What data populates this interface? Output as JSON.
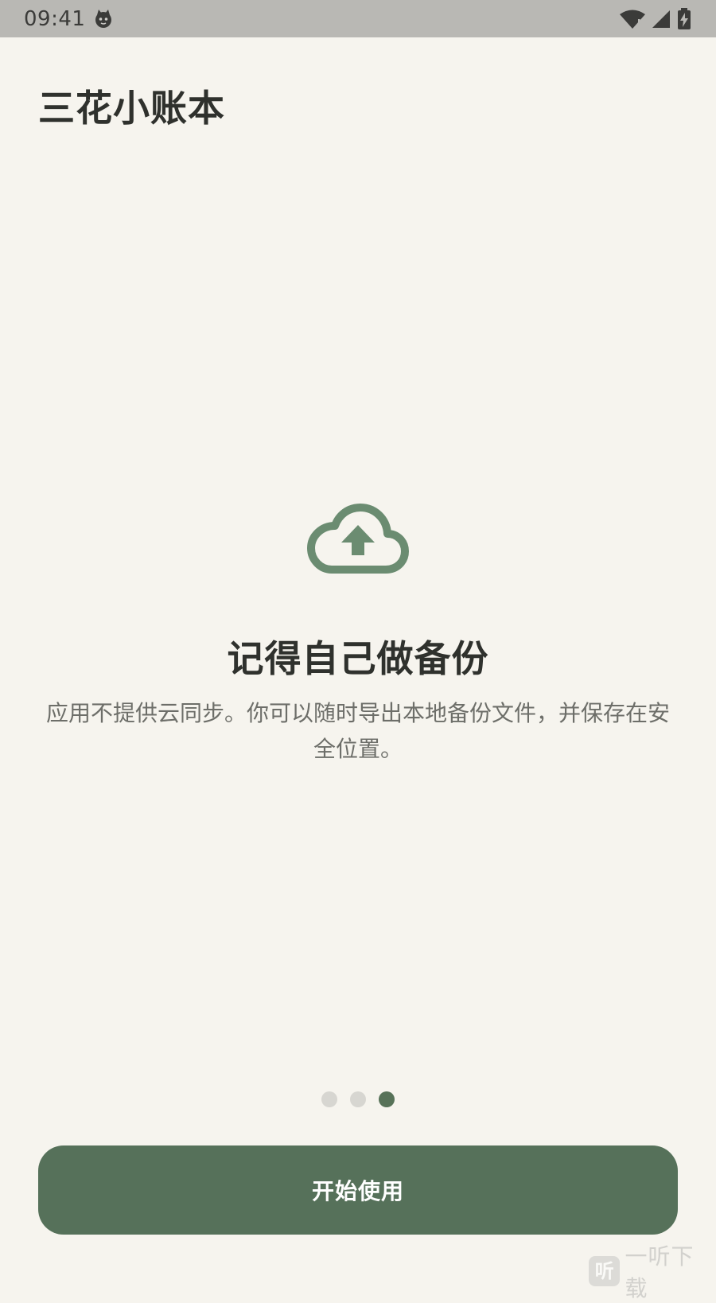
{
  "status_bar": {
    "time": "09:41",
    "icons": [
      "cat-face-icon",
      "wifi-icon",
      "cell-signal-icon",
      "battery-charging-icon"
    ]
  },
  "header": {
    "title": "三花小账本"
  },
  "onboarding": {
    "icon": "cloud-upload-icon",
    "heading": "记得自己做备份",
    "description": "应用不提供云同步。你可以随时导出本地备份文件，并保存在安全位置。",
    "page_count": 3,
    "current_page": 3
  },
  "actions": {
    "start_label": "开始使用"
  },
  "watermark": {
    "badge": "听",
    "text": "一听下载"
  },
  "colors": {
    "background": "#f6f4ee",
    "accent": "#56715a",
    "icon": "#6b8c71",
    "dot_inactive": "#d7d6d1",
    "status_bar": "#b9b8b4"
  }
}
